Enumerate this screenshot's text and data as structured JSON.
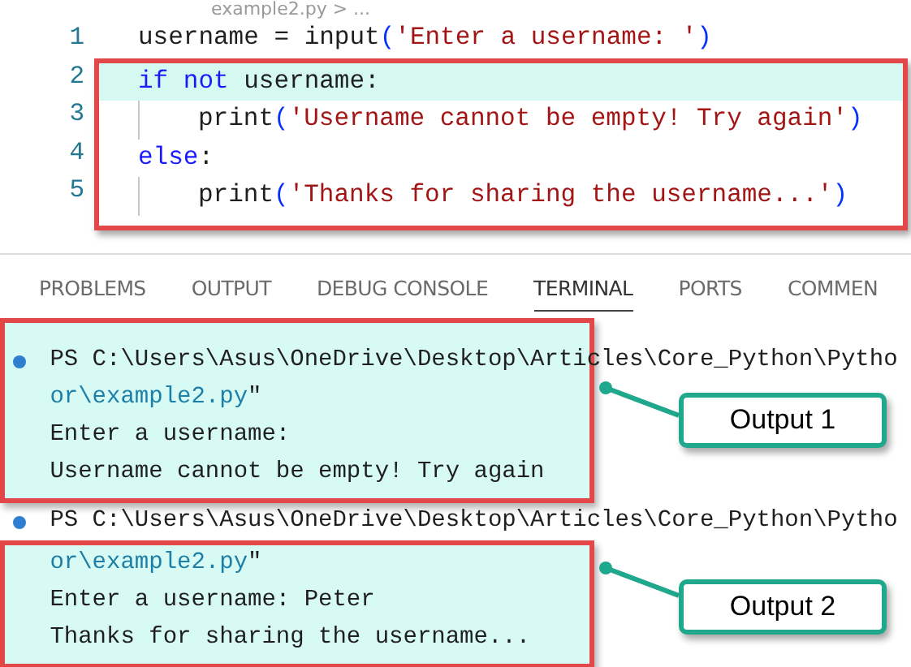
{
  "breadcrumb": "example2.py > ...",
  "code": {
    "blocks": [
      {
        "boxed": false,
        "lines": [
          {
            "number": "1",
            "highlighted": false,
            "guide": false,
            "tokens": [
              {
                "kind": "plain",
                "text": "username = input"
              },
              {
                "kind": "paren",
                "text": "("
              },
              {
                "kind": "string",
                "text": "'Enter a username: '"
              },
              {
                "kind": "paren",
                "text": ")"
              }
            ]
          }
        ]
      },
      {
        "boxed": true,
        "lines": [
          {
            "number": "2",
            "highlighted": true,
            "guide": false,
            "tokens": [
              {
                "kind": "keyword",
                "text": "if not"
              },
              {
                "kind": "plain",
                "text": " username:"
              }
            ]
          },
          {
            "number": "3",
            "highlighted": false,
            "guide": true,
            "tokens": [
              {
                "kind": "plain",
                "text": "print"
              },
              {
                "kind": "paren",
                "text": "("
              },
              {
                "kind": "string",
                "text": "'Username cannot be empty! Try again'"
              },
              {
                "kind": "paren",
                "text": ")"
              }
            ]
          },
          {
            "number": "4",
            "highlighted": false,
            "guide": false,
            "tokens": [
              {
                "kind": "keyword",
                "text": "else"
              },
              {
                "kind": "plain",
                "text": ":"
              }
            ]
          },
          {
            "number": "5",
            "highlighted": false,
            "guide": true,
            "tokens": [
              {
                "kind": "plain",
                "text": "print"
              },
              {
                "kind": "paren",
                "text": "("
              },
              {
                "kind": "string",
                "text": "'Thanks for sharing the username...'"
              },
              {
                "kind": "paren",
                "text": ")"
              }
            ]
          }
        ]
      }
    ]
  },
  "panel_tabs": [
    {
      "label": "PROBLEMS",
      "selected": false
    },
    {
      "label": "OUTPUT",
      "selected": false
    },
    {
      "label": "DEBUG CONSOLE",
      "selected": false
    },
    {
      "label": "TERMINAL",
      "selected": true
    },
    {
      "label": "PORTS",
      "selected": false
    },
    {
      "label": "COMMEN",
      "selected": false
    }
  ],
  "terminal": {
    "segments": [
      {
        "boxed": true,
        "callout": "Output 1",
        "lines": [
          {
            "kind": "prompt",
            "tokens": [
              {
                "kind": "plain",
                "text": "PS C:\\Users\\Asus\\OneDrive\\Desktop\\Articles\\Core_Python\\Pytho"
              }
            ]
          },
          {
            "kind": "output",
            "tokens": [
              {
                "kind": "path",
                "text": "or\\example2.py"
              },
              {
                "kind": "plain",
                "text": "\""
              }
            ]
          },
          {
            "kind": "output",
            "tokens": [
              {
                "kind": "plain",
                "text": "Enter a username:"
              }
            ]
          },
          {
            "kind": "output",
            "tokens": [
              {
                "kind": "plain",
                "text": "Username cannot be empty! Try again"
              }
            ]
          }
        ]
      },
      {
        "boxed": false,
        "lines": [
          {
            "kind": "prompt",
            "tokens": [
              {
                "kind": "plain",
                "text": "PS C:\\Users\\Asus\\OneDrive\\Desktop\\Articles\\Core_Python\\Pytho"
              }
            ]
          }
        ]
      },
      {
        "boxed": true,
        "callout": "Output 2",
        "lines": [
          {
            "kind": "output",
            "tokens": [
              {
                "kind": "path",
                "text": "or\\example2.py"
              },
              {
                "kind": "plain",
                "text": "\""
              }
            ]
          },
          {
            "kind": "output",
            "tokens": [
              {
                "kind": "plain",
                "text": "Enter a username: Peter"
              }
            ]
          },
          {
            "kind": "output",
            "tokens": [
              {
                "kind": "plain",
                "text": "Thanks for sharing the username..."
              }
            ]
          }
        ]
      }
    ]
  }
}
